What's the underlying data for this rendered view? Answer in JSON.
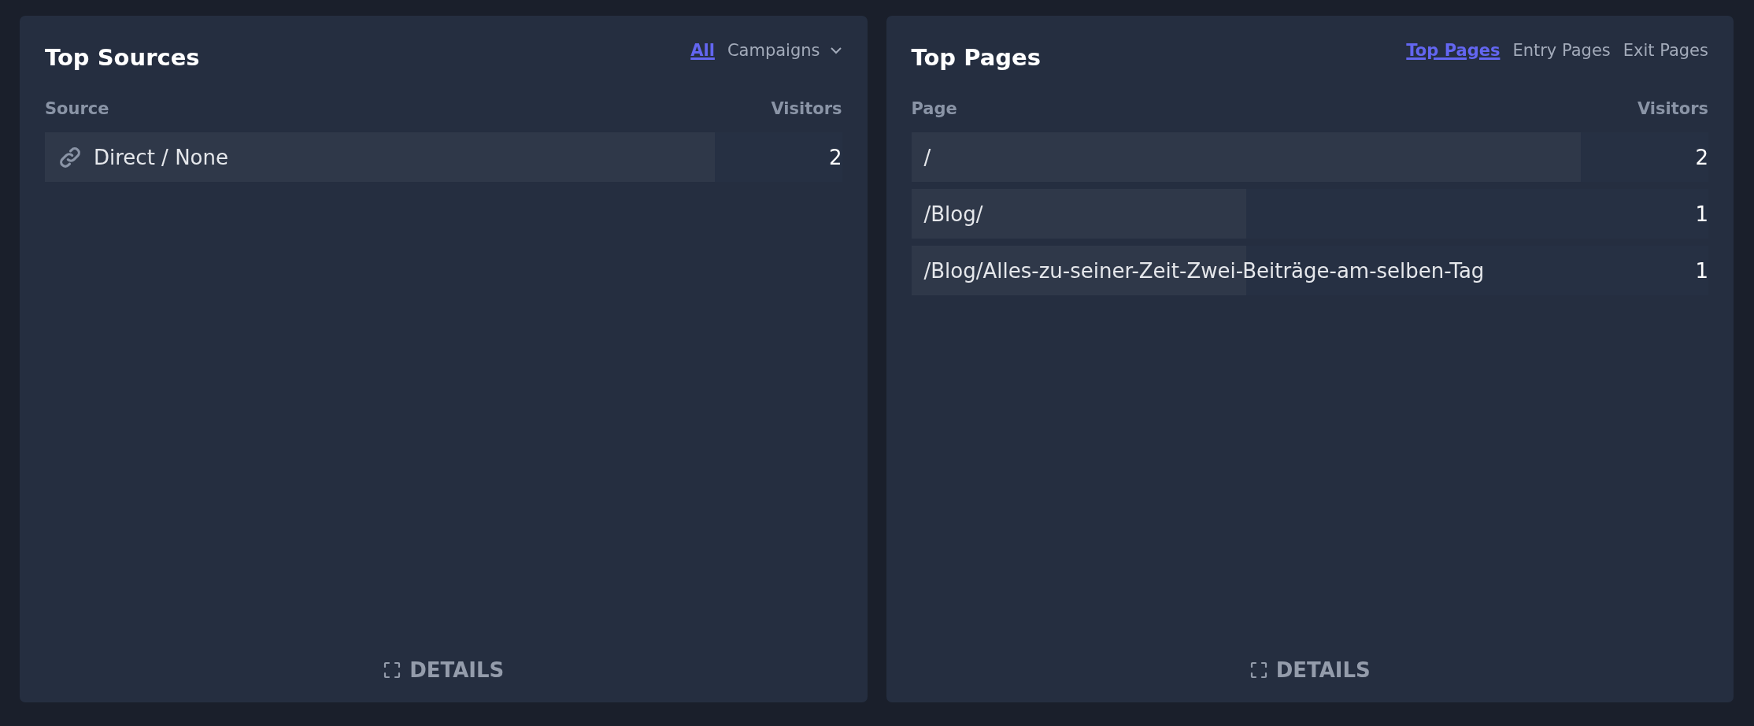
{
  "panels": [
    {
      "title": "Top Sources",
      "tabs": [
        {
          "label": "All",
          "selected": true,
          "kind": "tab"
        },
        {
          "label": "Campaigns",
          "selected": false,
          "kind": "dropdown"
        }
      ],
      "columns": [
        "Source",
        "Visitors"
      ],
      "rows": [
        {
          "label": "Direct / None",
          "visitors": "2",
          "level": 0.84
        }
      ],
      "details": "DETAILS"
    },
    {
      "title": "Top Pages",
      "tabs": [
        {
          "label": "Top Pages",
          "selected": true,
          "kind": "tab"
        },
        {
          "label": "Entry Pages",
          "selected": false,
          "kind": "tab"
        },
        {
          "label": "Exit Pages",
          "selected": false,
          "kind": "tab"
        }
      ],
      "columns": [
        "Page",
        "Visitors"
      ],
      "rows": [
        {
          "label": "/",
          "visitors": "2",
          "level": 0.84
        },
        {
          "label": "/Blog/",
          "visitors": "1",
          "level": 0.42
        },
        {
          "label": "/Blog/Alles-zu-seiner-Zeit-Zwei-Beiträge-am-selben-Tag",
          "visitors": "1",
          "level": 0.42
        }
      ],
      "details": "DETAILS"
    }
  ]
}
